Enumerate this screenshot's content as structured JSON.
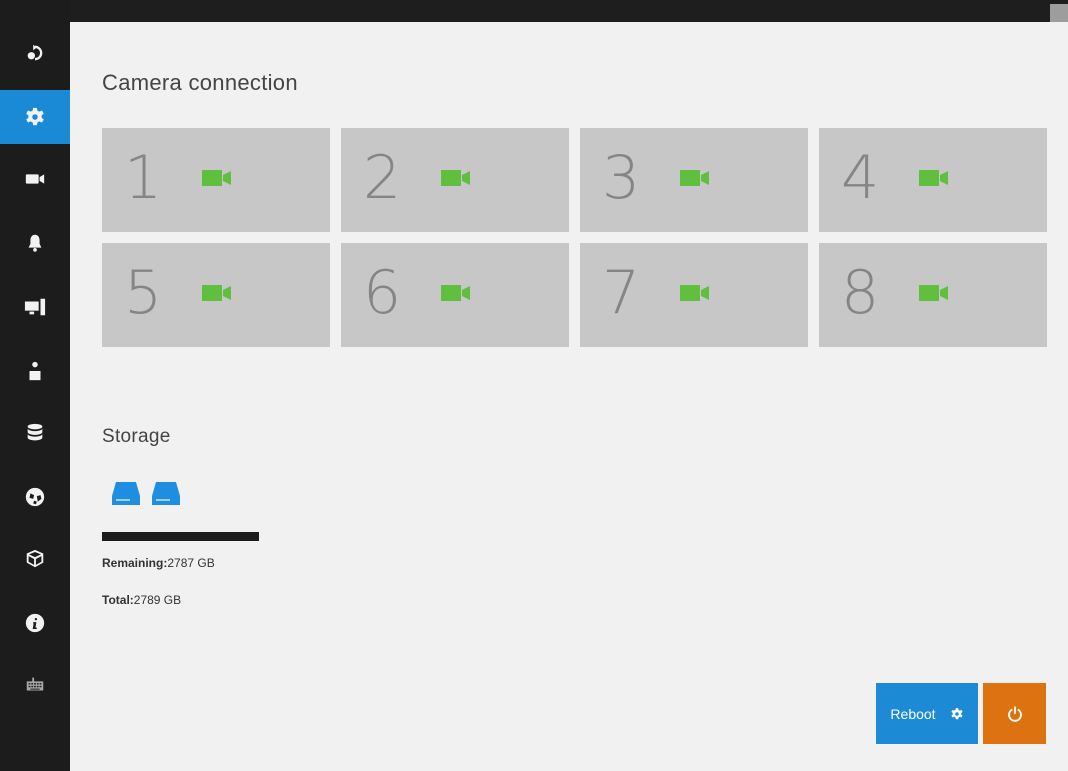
{
  "sidebar": {
    "items": [
      {
        "name": "logout",
        "icon": "logout-icon"
      },
      {
        "name": "settings",
        "icon": "gear-icon",
        "active": true
      },
      {
        "name": "camera",
        "icon": "video-camera-icon"
      },
      {
        "name": "alarm",
        "icon": "bell-icon"
      },
      {
        "name": "system",
        "icon": "computer-icon"
      },
      {
        "name": "user",
        "icon": "user-icon"
      },
      {
        "name": "storage",
        "icon": "database-icon"
      },
      {
        "name": "network",
        "icon": "globe-icon"
      },
      {
        "name": "package",
        "icon": "box-icon"
      },
      {
        "name": "info",
        "icon": "info-icon"
      },
      {
        "name": "keyboard",
        "icon": "keyboard-icon"
      }
    ],
    "active_color": "#1a8ad6"
  },
  "camera_connection": {
    "title": "Camera connection",
    "cameras": [
      {
        "number": "1",
        "status": "connected"
      },
      {
        "number": "2",
        "status": "connected"
      },
      {
        "number": "3",
        "status": "connected"
      },
      {
        "number": "4",
        "status": "connected"
      },
      {
        "number": "5",
        "status": "connected"
      },
      {
        "number": "6",
        "status": "connected"
      },
      {
        "number": "7",
        "status": "connected"
      },
      {
        "number": "8",
        "status": "connected"
      }
    ],
    "connected_color": "#61bf3f"
  },
  "storage": {
    "title": "Storage",
    "disk_count": 2,
    "remaining_label": "Remaining:",
    "remaining_value": "2787 GB",
    "total_label": "Total:",
    "total_value": "2789 GB",
    "used_fraction": 0.0007
  },
  "actions": {
    "reboot_label": "Reboot",
    "reboot_color": "#1d8ad6",
    "power_color": "#dd7310"
  }
}
